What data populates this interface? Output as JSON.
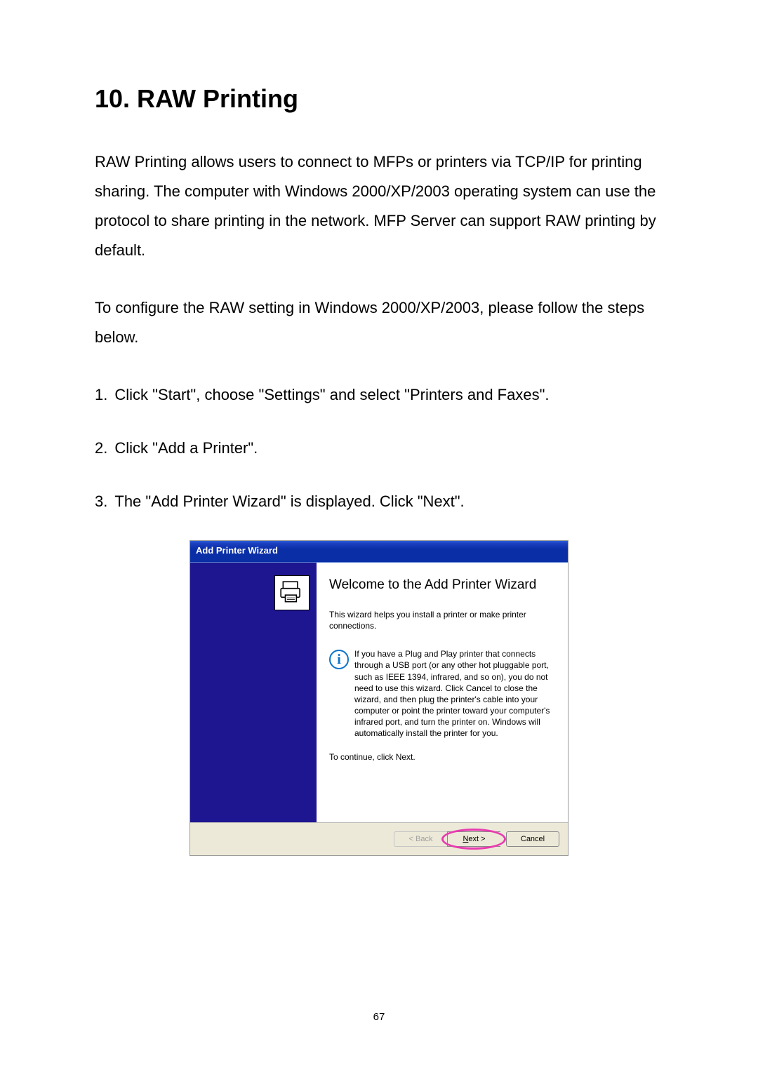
{
  "heading": "10. RAW Printing",
  "para1": "RAW Printing allows users to connect to MFPs or printers via TCP/IP for printing sharing. The computer with Windows 2000/XP/2003 operating system can use the protocol to share printing in the network. MFP Server can support RAW printing by default.",
  "para2": "To configure the RAW setting in Windows 2000/XP/2003, please follow the steps below.",
  "steps": [
    {
      "n": "1",
      "text": "Click \"Start\", choose \"Settings\" and select \"Printers and Faxes\"."
    },
    {
      "n": "2",
      "text": "Click \"Add a Printer\"."
    },
    {
      "n": "3",
      "text": "The \"Add Printer Wizard\" is displayed. Click \"Next\"."
    }
  ],
  "wizard": {
    "title": "Add Printer Wizard",
    "heading": "Welcome to the Add Printer Wizard",
    "subtext": "This wizard helps you install a printer or make printer connections.",
    "info": "If you have a Plug and Play printer that connects through a USB port (or any other hot pluggable port, such as IEEE 1394, infrared, and so on), you do not need to use this wizard. Click Cancel to close the wizard, and then plug the printer's cable into your computer or point the printer toward your computer's infrared port, and turn the printer on. Windows will automatically install the printer for you.",
    "continue": "To continue, click Next.",
    "buttons": {
      "back": "< Back",
      "next": "Next >",
      "cancel": "Cancel"
    }
  },
  "pageNumber": "67"
}
